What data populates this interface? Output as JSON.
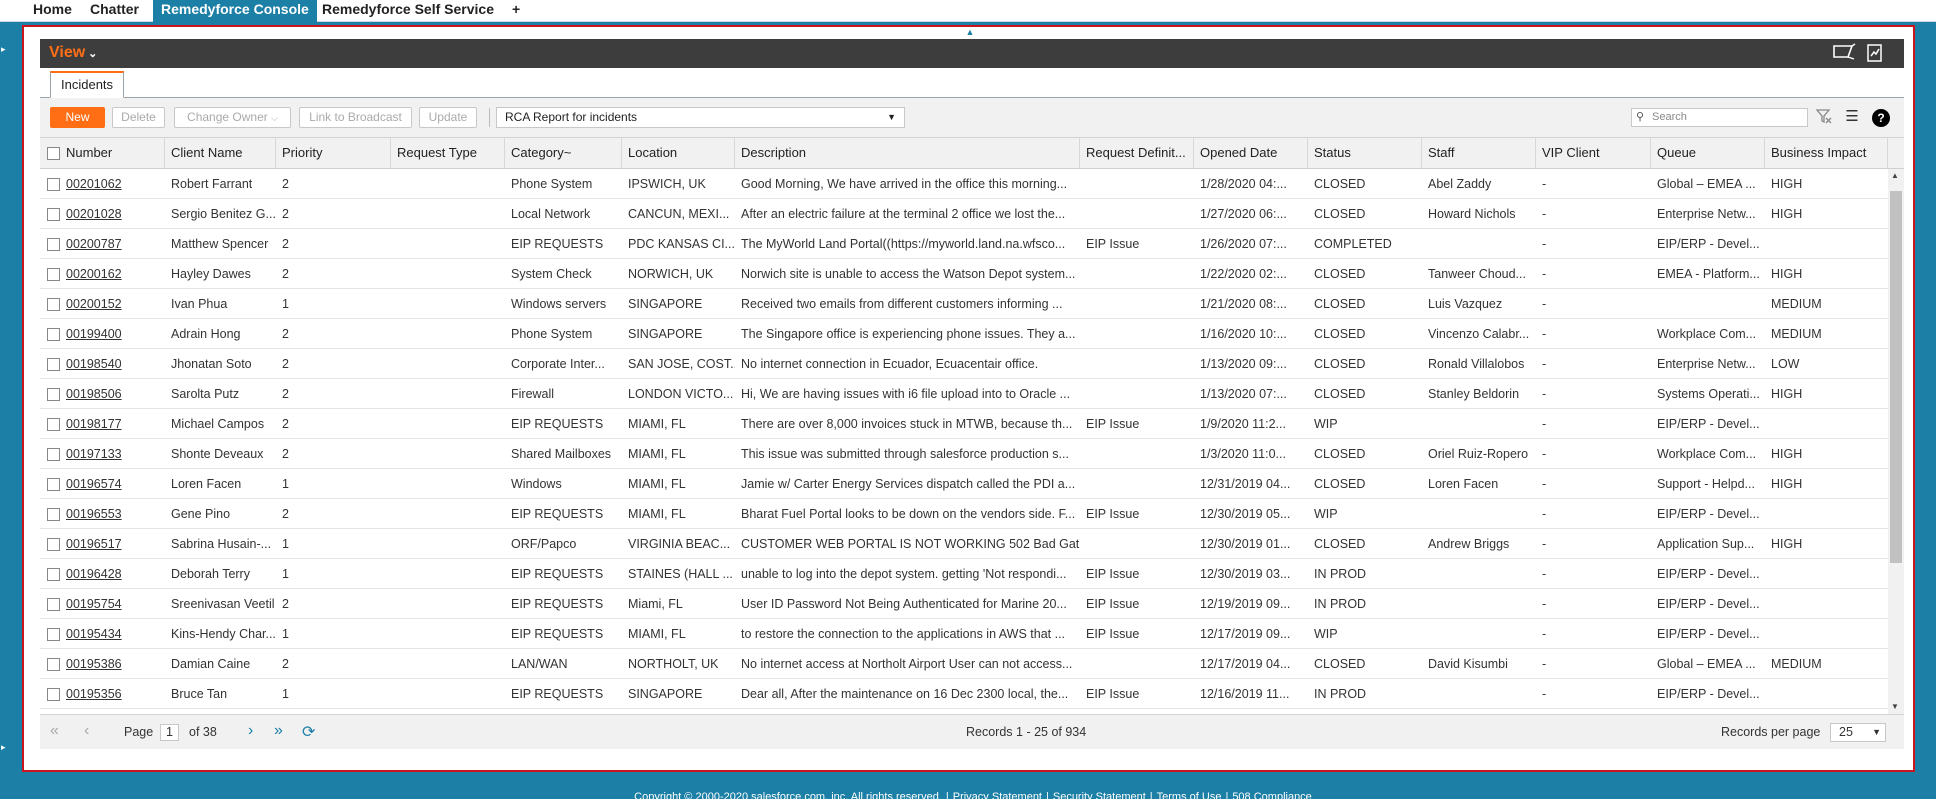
{
  "top_tabs": [
    {
      "label": "Home"
    },
    {
      "label": "Chatter"
    },
    {
      "label": "Remedyforce Console"
    },
    {
      "label": "Remedyforce Self Service"
    },
    {
      "label": "+"
    }
  ],
  "view": {
    "label": "View",
    "chevron": "⌄"
  },
  "subtab": {
    "label": "Incidents"
  },
  "toolbar": {
    "new": "New",
    "delete": "Delete",
    "change_owner": "Change Owner",
    "link_broadcast": "Link to Broadcast",
    "update": "Update",
    "report": "RCA Report for incidents",
    "search_placeholder": "Search"
  },
  "columns": [
    "Number",
    "Client Name",
    "Priority",
    "Request Type",
    "Category",
    "Location",
    "Description",
    "Request Definit...",
    "Opened Date",
    "Status",
    "Staff",
    "VIP Client",
    "Queue",
    "Business Impact"
  ],
  "category_sort": "~",
  "rows": [
    {
      "number": "00201062",
      "client": "Robert Farrant",
      "priority": "2",
      "reqtype": "",
      "category": "Phone System",
      "location": "IPSWICH, UK",
      "description": "Good Morning, We have arrived in the office this morning...",
      "reqdef": "",
      "opened": "1/28/2020 04:...",
      "status": "CLOSED",
      "staff": "Abel Zaddy",
      "vip": "-",
      "queue": "Global – EMEA ...",
      "impact": "HIGH"
    },
    {
      "number": "00201028",
      "client": "Sergio Benitez G...",
      "priority": "2",
      "reqtype": "",
      "category": "Local Network",
      "location": "CANCUN, MEXI...",
      "description": "After an electric failure at the terminal 2 office we lost the...",
      "reqdef": "",
      "opened": "1/27/2020 06:...",
      "status": "CLOSED",
      "staff": "Howard Nichols",
      "vip": "-",
      "queue": "Enterprise Netw...",
      "impact": "HIGH"
    },
    {
      "number": "00200787",
      "client": "Matthew Spencer",
      "priority": "2",
      "reqtype": "",
      "category": "EIP REQUESTS",
      "location": "PDC KANSAS CI...",
      "description": "The MyWorld Land Portal((https://myworld.land.na.wfsco...",
      "reqdef": "EIP Issue",
      "opened": "1/26/2020 07:...",
      "status": "COMPLETED",
      "staff": "",
      "vip": "-",
      "queue": "EIP/ERP - Devel...",
      "impact": ""
    },
    {
      "number": "00200162",
      "client": "Hayley Dawes",
      "priority": "2",
      "reqtype": "",
      "category": "System Check",
      "location": "NORWICH, UK",
      "description": "Norwich site is unable to access the Watson Depot system...",
      "reqdef": "",
      "opened": "1/22/2020 02:...",
      "status": "CLOSED",
      "staff": "Tanweer Choud...",
      "vip": "-",
      "queue": "EMEA - Platform...",
      "impact": "HIGH"
    },
    {
      "number": "00200152",
      "client": "Ivan Phua",
      "priority": "1",
      "reqtype": "",
      "category": "Windows servers",
      "location": "SINGAPORE",
      "description": "Received two emails from different customers informing ...",
      "reqdef": "",
      "opened": "1/21/2020 08:...",
      "status": "CLOSED",
      "staff": "Luis Vazquez",
      "vip": "-",
      "queue": "",
      "impact": "MEDIUM"
    },
    {
      "number": "00199400",
      "client": "Adrain Hong",
      "priority": "2",
      "reqtype": "",
      "category": "Phone System",
      "location": "SINGAPORE",
      "description": "The Singapore office is experiencing phone issues. They a...",
      "reqdef": "",
      "opened": "1/16/2020 10:...",
      "status": "CLOSED",
      "staff": "Vincenzo Calabr...",
      "vip": "-",
      "queue": "Workplace Com...",
      "impact": "MEDIUM"
    },
    {
      "number": "00198540",
      "client": "Jhonatan Soto",
      "priority": "2",
      "reqtype": "",
      "category": "Corporate Inter...",
      "location": "SAN JOSE, COST...",
      "description": "No internet connection in Ecuador, Ecuacentair office.",
      "reqdef": "",
      "opened": "1/13/2020 09:...",
      "status": "CLOSED",
      "staff": "Ronald Villalobos",
      "vip": "-",
      "queue": "Enterprise Netw...",
      "impact": "LOW"
    },
    {
      "number": "00198506",
      "client": "Sarolta Putz",
      "priority": "2",
      "reqtype": "",
      "category": "Firewall",
      "location": "LONDON VICTO...",
      "description": "Hi, We are having issues with i6 file upload into to Oracle ...",
      "reqdef": "",
      "opened": "1/13/2020 07:...",
      "status": "CLOSED",
      "staff": "Stanley Beldorin",
      "vip": "-",
      "queue": "Systems Operati...",
      "impact": "HIGH"
    },
    {
      "number": "00198177",
      "client": "Michael Campos",
      "priority": "2",
      "reqtype": "",
      "category": "EIP REQUESTS",
      "location": "MIAMI, FL",
      "description": "There are over 8,000 invoices stuck in MTWB, because th...",
      "reqdef": "EIP Issue",
      "opened": "1/9/2020 11:2...",
      "status": "WIP",
      "staff": "",
      "vip": "-",
      "queue": "EIP/ERP - Devel...",
      "impact": ""
    },
    {
      "number": "00197133",
      "client": "Shonte Deveaux",
      "priority": "2",
      "reqtype": "",
      "category": "Shared Mailboxes",
      "location": "MIAMI, FL",
      "description": "This issue was submitted through salesforce production s...",
      "reqdef": "",
      "opened": "1/3/2020 11:0...",
      "status": "CLOSED",
      "staff": "Oriel Ruiz-Ropero",
      "vip": "-",
      "queue": "Workplace Com...",
      "impact": "HIGH"
    },
    {
      "number": "00196574",
      "client": "Loren Facen",
      "priority": "1",
      "reqtype": "",
      "category": "Windows",
      "location": "MIAMI, FL",
      "description": "Jamie w/ Carter Energy Services dispatch called the PDI a...",
      "reqdef": "",
      "opened": "12/31/2019 04...",
      "status": "CLOSED",
      "staff": "Loren Facen",
      "vip": "-",
      "queue": "Support - Helpd...",
      "impact": "HIGH"
    },
    {
      "number": "00196553",
      "client": "Gene Pino",
      "priority": "2",
      "reqtype": "",
      "category": "EIP REQUESTS",
      "location": "MIAMI, FL",
      "description": "Bharat Fuel Portal looks to be down on the vendors side. F...",
      "reqdef": "EIP Issue",
      "opened": "12/30/2019 05...",
      "status": "WIP",
      "staff": "",
      "vip": "-",
      "queue": "EIP/ERP - Devel...",
      "impact": ""
    },
    {
      "number": "00196517",
      "client": "Sabrina Husain-...",
      "priority": "1",
      "reqtype": "",
      "category": "ORF/Papco",
      "location": "VIRGINIA BEAC...",
      "description": "CUSTOMER WEB PORTAL IS NOT WORKING 502 Bad Gat...",
      "reqdef": "",
      "opened": "12/30/2019 01...",
      "status": "CLOSED",
      "staff": "Andrew Briggs",
      "vip": "-",
      "queue": "Application Sup...",
      "impact": "HIGH"
    },
    {
      "number": "00196428",
      "client": "Deborah Terry",
      "priority": "1",
      "reqtype": "",
      "category": "EIP REQUESTS",
      "location": "STAINES (HALL ...",
      "description": "unable to log into the depot system. getting 'Not respondi...",
      "reqdef": "EIP Issue",
      "opened": "12/30/2019 03...",
      "status": "IN PROD",
      "staff": "",
      "vip": "-",
      "queue": "EIP/ERP - Devel...",
      "impact": ""
    },
    {
      "number": "00195754",
      "client": "Sreenivasan Veetil",
      "priority": "2",
      "reqtype": "",
      "category": "EIP REQUESTS",
      "location": "Miami, FL",
      "description": "User ID Password Not Being Authenticated for Marine 20...",
      "reqdef": "EIP Issue",
      "opened": "12/19/2019 09...",
      "status": "IN PROD",
      "staff": "",
      "vip": "-",
      "queue": "EIP/ERP - Devel...",
      "impact": ""
    },
    {
      "number": "00195434",
      "client": "Kins-Hendy Char...",
      "priority": "1",
      "reqtype": "",
      "category": "EIP REQUESTS",
      "location": "MIAMI, FL",
      "description": "to restore the connection to the applications in AWS that ...",
      "reqdef": "EIP Issue",
      "opened": "12/17/2019 09...",
      "status": "WIP",
      "staff": "",
      "vip": "-",
      "queue": "EIP/ERP - Devel...",
      "impact": ""
    },
    {
      "number": "00195386",
      "client": "Damian Caine",
      "priority": "2",
      "reqtype": "",
      "category": "LAN/WAN",
      "location": "NORTHOLT, UK",
      "description": "No internet access at Northolt Airport User can not access...",
      "reqdef": "",
      "opened": "12/17/2019 04...",
      "status": "CLOSED",
      "staff": "David Kisumbi",
      "vip": "-",
      "queue": "Global – EMEA ...",
      "impact": "MEDIUM"
    },
    {
      "number": "00195356",
      "client": "Bruce Tan",
      "priority": "1",
      "reqtype": "",
      "category": "EIP REQUESTS",
      "location": "SINGAPORE",
      "description": "Dear all, After the maintenance on 16 Dec 2300 local, the...",
      "reqdef": "EIP Issue",
      "opened": "12/16/2019 11...",
      "status": "IN PROD",
      "staff": "",
      "vip": "-",
      "queue": "EIP/ERP - Devel...",
      "impact": ""
    }
  ],
  "pager": {
    "page_label": "Page",
    "page": "1",
    "of_label": "of 38",
    "records": "Records 1 - 25 of 934",
    "rpp_label": "Records per page",
    "rpp": "25"
  },
  "footer": [
    "Copyright © 2000-2020 salesforce.com, inc. All rights reserved.",
    "|",
    "Privacy Statement",
    "|",
    "Security Statement",
    "|",
    "Terms of Use",
    "|",
    "508 Compliance"
  ],
  "colors": {
    "accent": "#ff6e15",
    "brand": "#1c7fa6",
    "frame": "#c9151e"
  }
}
